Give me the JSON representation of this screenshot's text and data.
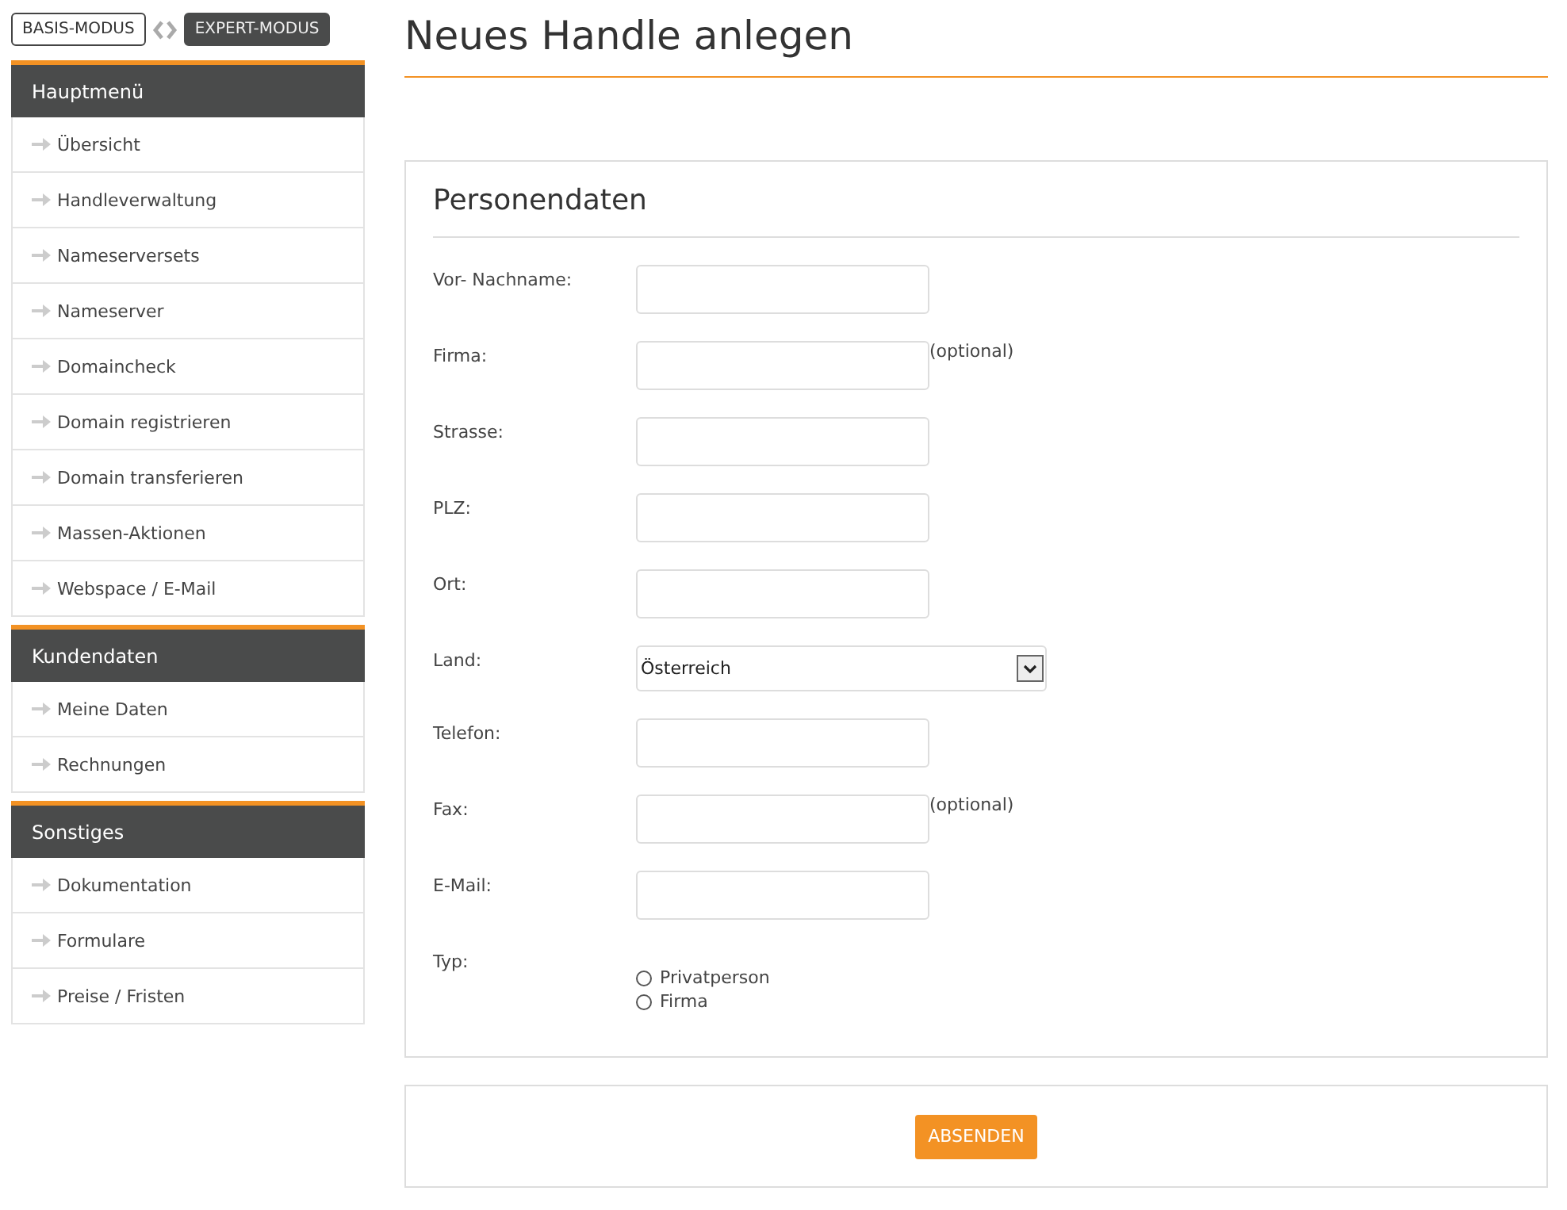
{
  "mode_switch": {
    "options": [
      {
        "label": "BASIS-MODUS",
        "selected": false
      },
      {
        "label": "EXPERT-MODUS",
        "selected": true
      }
    ]
  },
  "sidebar": {
    "sections": [
      {
        "title": "Hauptmenü",
        "items": [
          "Übersicht",
          "Handleverwaltung",
          "Nameserversets",
          "Nameserver",
          "Domaincheck",
          "Domain registrieren",
          "Domain transferieren",
          "Massen-Aktionen",
          "Webspace / E-Mail"
        ]
      },
      {
        "title": "Kundendaten",
        "items": [
          "Meine Daten",
          "Rechnungen"
        ]
      },
      {
        "title": "Sonstiges",
        "items": [
          "Dokumentation",
          "Formulare",
          "Preise / Fristen"
        ]
      }
    ]
  },
  "page_title": "Neues Handle anlegen",
  "form": {
    "title": "Personendaten",
    "fields": [
      {
        "label": "Vor- Nachname:",
        "kind": "text"
      },
      {
        "label": "Firma:",
        "kind": "text",
        "note": "(optional)"
      },
      {
        "label": "Strasse:",
        "kind": "text"
      },
      {
        "label": "PLZ:",
        "kind": "text"
      },
      {
        "label": "Ort:",
        "kind": "text"
      },
      {
        "label": "Land:",
        "kind": "select",
        "value": "Österreich"
      },
      {
        "label": "Telefon:",
        "kind": "text"
      },
      {
        "label": "Fax:",
        "kind": "text",
        "note": "(optional)"
      },
      {
        "label": "E-Mail:",
        "kind": "text"
      },
      {
        "label": "Typ:",
        "kind": "radio",
        "options": [
          {
            "label": "Privatperson",
            "selected": false
          },
          {
            "label": "Firma",
            "selected": false
          }
        ]
      }
    ]
  },
  "submit_button": "ABSENDEN"
}
